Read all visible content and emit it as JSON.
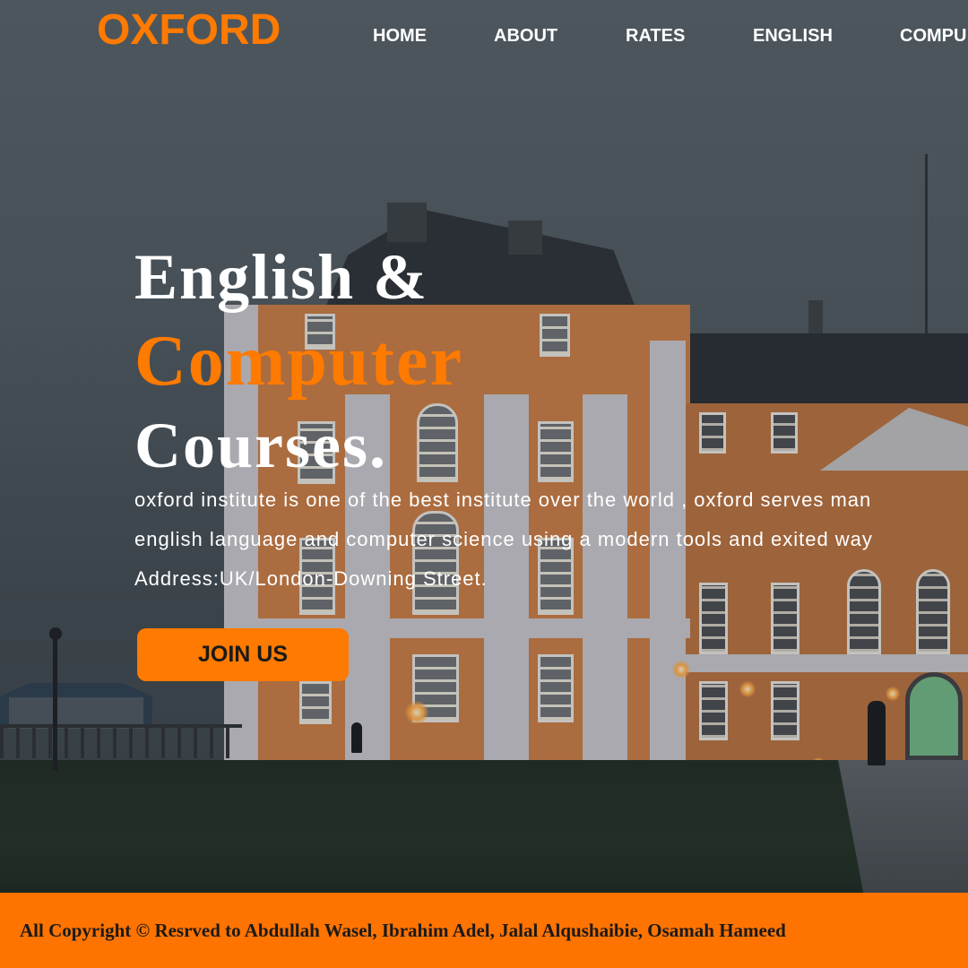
{
  "header": {
    "logo": "OXFORD",
    "nav": [
      {
        "label": "HOME"
      },
      {
        "label": "ABOUT"
      },
      {
        "label": "RATES"
      },
      {
        "label": "ENGLISH"
      },
      {
        "label": "COMPU"
      }
    ]
  },
  "hero": {
    "title_line1": "English &",
    "title_line2": "Computer",
    "title_line3": "Courses.",
    "desc_line1": "oxford institute is one of the best institute over the world , oxford serves man",
    "desc_line2": "english language and computer science using a modern tools and exited way",
    "address": "Address:UK/London-Downing Street.",
    "join_label": "JOIN US",
    "background_image": "building-photo"
  },
  "footer": {
    "copyright": "All Copyright © Resrved to Abdullah Wasel, Ibrahim Adel, Jalal Alqushaibie, Osamah Hameed"
  },
  "colors": {
    "accent": "#ff7a00",
    "footer_bg": "#ff7300",
    "text_light": "#ffffff"
  }
}
